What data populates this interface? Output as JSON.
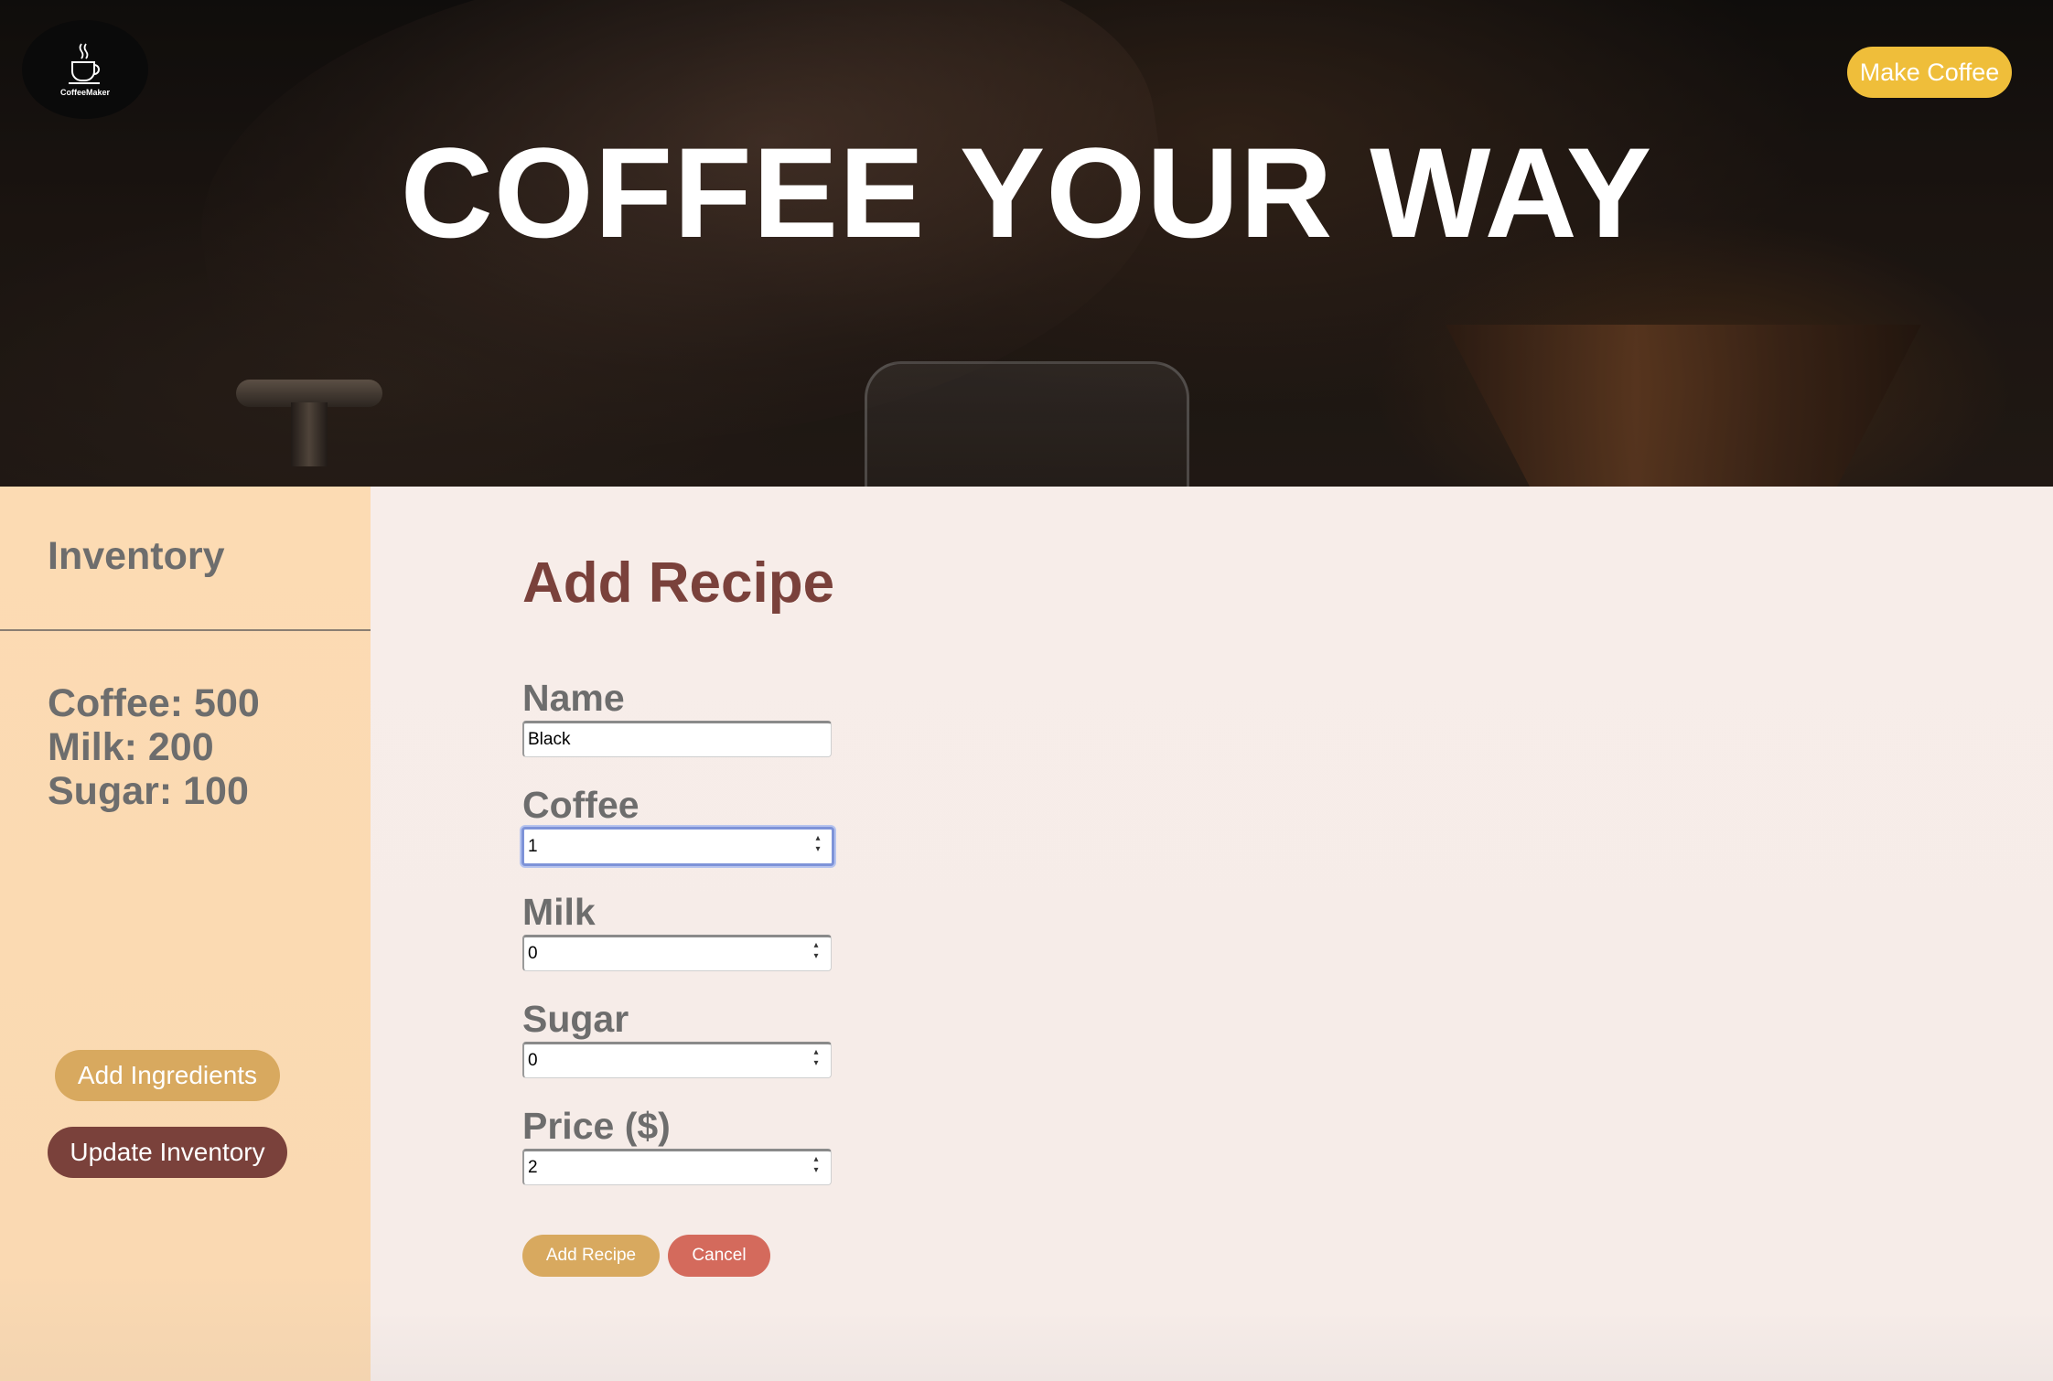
{
  "header": {
    "logo_text": "CoffeeMaker",
    "make_coffee_label": "Make Coffee",
    "hero_title": "COFFEE YOUR WAY"
  },
  "sidebar": {
    "title": "Inventory",
    "items": [
      {
        "label": "Coffee: 500"
      },
      {
        "label": "Milk: 200"
      },
      {
        "label": "Sugar: 100"
      }
    ],
    "add_ingredients_label": "Add Ingredients",
    "update_inventory_label": "Update Inventory"
  },
  "form": {
    "title": "Add Recipe",
    "fields": [
      {
        "label": "Name",
        "value": "Black",
        "type": "text"
      },
      {
        "label": "Coffee",
        "value": "1",
        "type": "number",
        "focused": true
      },
      {
        "label": "Milk",
        "value": "0",
        "type": "number"
      },
      {
        "label": "Sugar",
        "value": "0",
        "type": "number"
      },
      {
        "label": "Price ($)",
        "value": "2",
        "type": "number"
      }
    ],
    "submit_label": "Add Recipe",
    "cancel_label": "Cancel"
  },
  "colors": {
    "accent_yellow": "#efbe3a",
    "button_tan": "#d8a95f",
    "button_maroon": "#7a413b",
    "button_red": "#d46a5c",
    "sidebar_bg": "#fcdbb3",
    "main_bg": "#f7ede9",
    "focus_ring": "#7e93d8"
  }
}
